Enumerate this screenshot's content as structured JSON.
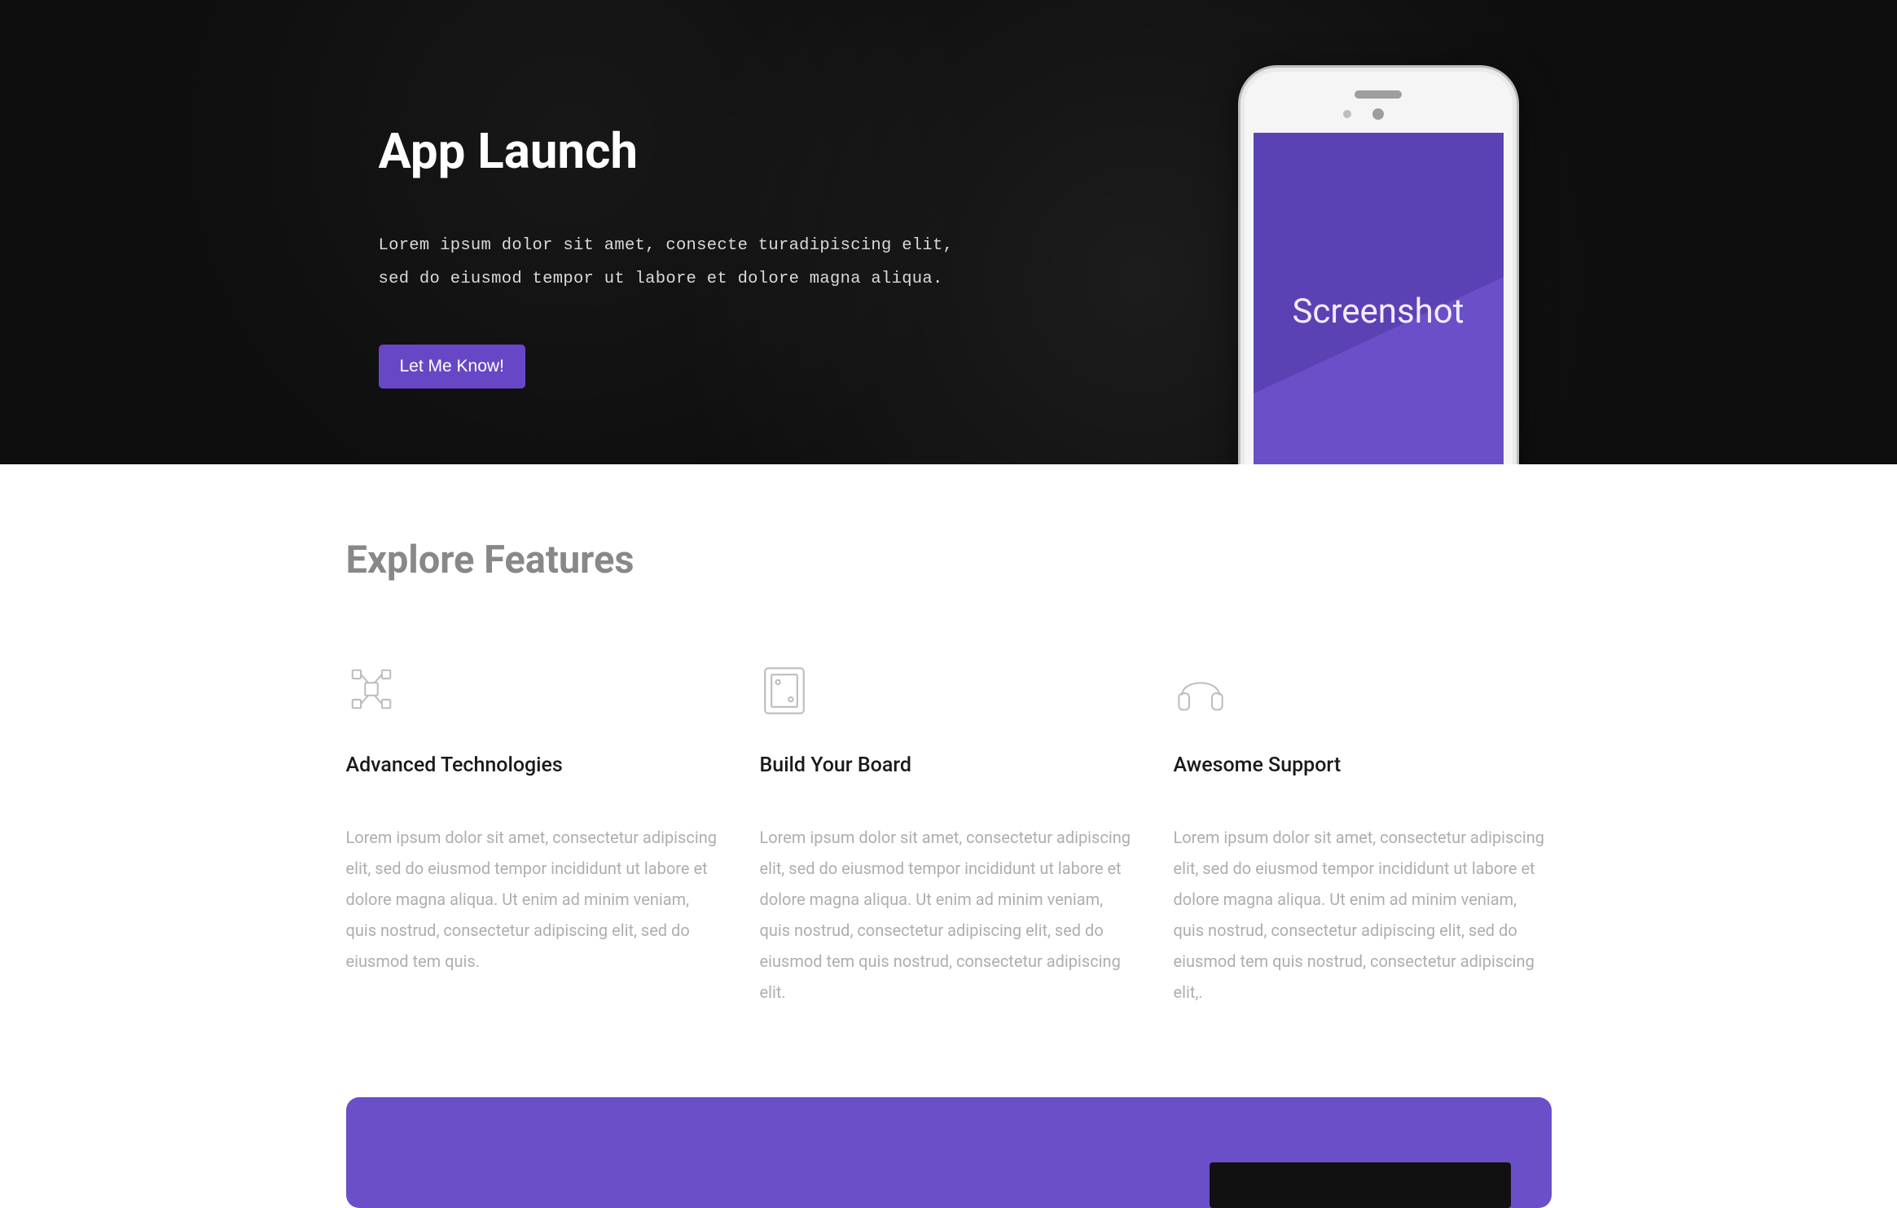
{
  "hero": {
    "title": "App Launch",
    "description": "Lorem ipsum dolor sit amet, consecte turadipiscing elit,\nsed do eiusmod tempor ut labore et dolore magna aliqua.",
    "cta_label": "Let Me Know!",
    "phone_screen_text": "Screenshot"
  },
  "features": {
    "section_title": "Explore Features",
    "items": [
      {
        "icon": "chip-icon",
        "heading": "Advanced Technologies",
        "body": "Lorem ipsum dolor sit amet, consectetur adipiscing elit, sed do eiusmod tempor incididunt ut labore et dolore magna aliqua. Ut enim ad minim veniam, quis nostrud, consectetur adipiscing elit, sed do eiusmod tem quis."
      },
      {
        "icon": "board-icon",
        "heading": "Build Your Board",
        "body": "Lorem ipsum dolor sit amet, consectetur adipiscing elit, sed do eiusmod tempor incididunt ut labore et dolore magna aliqua. Ut enim ad minim veniam, quis nostrud, consectetur adipiscing elit, sed do eiusmod tem quis nostrud, consectetur adipiscing elit."
      },
      {
        "icon": "headphones-icon",
        "heading": "Awesome Support",
        "body": "Lorem ipsum dolor sit amet, consectetur adipiscing elit, sed do eiusmod tempor incididunt ut labore et dolore magna aliqua. Ut enim ad minim veniam, quis nostrud, consectetur adipiscing elit, sed do eiusmod tem quis nostrud, consectetur adipiscing elit,."
      }
    ]
  },
  "signup": {
    "input_placeholder": ""
  }
}
